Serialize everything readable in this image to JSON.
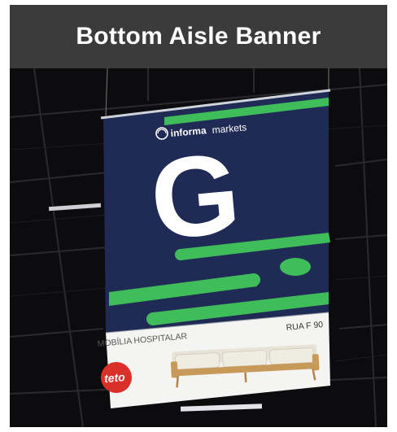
{
  "header": {
    "title": "Bottom Aisle Banner"
  },
  "banner": {
    "brand_bold": "informa",
    "brand_light": "markets",
    "letter": "G",
    "strip_label": "MOBÍLIA HOSPITALAR",
    "strip_address": "RUA F 90",
    "exhibitor_logo_text": "teto"
  },
  "colors": {
    "navy": "#1f2a55",
    "green": "#3fbd5a",
    "header_bg": "#3b3b3b",
    "logo_red": "#d9302a"
  }
}
